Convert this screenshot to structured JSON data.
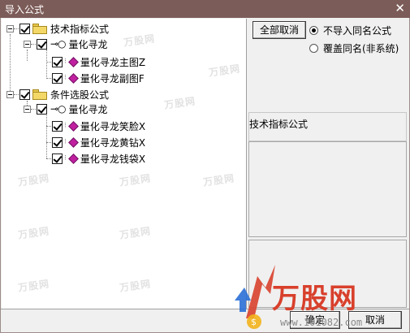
{
  "window": {
    "title": "导入公式",
    "close_glyph": "✕"
  },
  "tree": {
    "groups": [
      {
        "label": "技术指标公式",
        "sub": {
          "label": "量化寻龙",
          "items": [
            "量化寻龙主图Z",
            "量化寻龙副图F"
          ]
        }
      },
      {
        "label": "条件选股公式",
        "sub": {
          "label": "量化寻龙",
          "items": [
            "量化寻龙笑脸X",
            "量化寻龙黄钻X",
            "量化寻龙钱袋X"
          ]
        }
      }
    ]
  },
  "options": {
    "select_all_button": "全部取消",
    "radio_skip": "不导入同名公式",
    "radio_overwrite": "覆盖同名(非系统)",
    "selected": "radio_skip"
  },
  "description": {
    "label": "技术指标公式"
  },
  "footer": {
    "ok": "确定",
    "cancel": "取消"
  },
  "watermark": {
    "brand": "万股网",
    "url": "www.101082.com",
    "tile_text": "万股网",
    "colors": {
      "red": "#d8402c",
      "blue": "#2a6fd6",
      "yellow": "#f2b21c"
    }
  },
  "icons": {
    "folder": "folder-icon",
    "formula_group": "key-icon",
    "formula": "gem-icon"
  }
}
